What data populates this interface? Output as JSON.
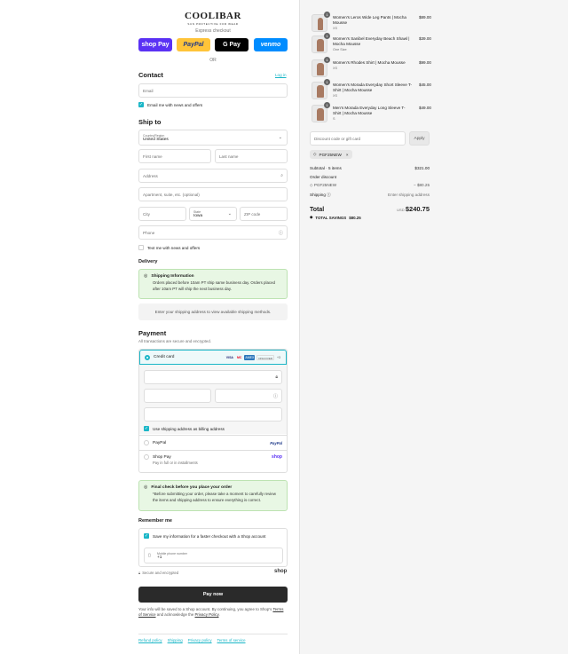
{
  "brand": {
    "name": "COOLIBAR",
    "tagline": "SUN PROTECTIVE FOR WEAR"
  },
  "express": {
    "label": "Express checkout",
    "buttons": [
      "shop Pay",
      "PayPal",
      "G Pay",
      "venmo"
    ],
    "or_label": "OR"
  },
  "contact": {
    "heading": "Contact",
    "login_link": "Log in",
    "email_placeholder": "Email",
    "news_label": "Email me with news and offers"
  },
  "ship": {
    "heading": "Ship to",
    "country_label": "Country/Region",
    "country_value": "United States",
    "first_name_placeholder": "First name",
    "last_name_placeholder": "Last name",
    "address_placeholder": "Address",
    "apt_placeholder": "Apartment, suite, etc. (optional)",
    "city_placeholder": "City",
    "state_label": "State",
    "state_value": "Iowa",
    "zip_placeholder": "ZIP code",
    "phone_placeholder": "Phone",
    "text_label": "Text me with news and offers"
  },
  "delivery": {
    "heading": "Delivery",
    "info_title": "Shipping Information",
    "info_body": "Orders placed before 10am PT ship same business day. Orders placed after 10am PT will ship the next business day.",
    "methods_note": "Enter your shipping address to view available shipping methods."
  },
  "payment": {
    "heading": "Payment",
    "subheading": "All transactions are secure and encrypted.",
    "credit_label": "Credit card",
    "card_brands": [
      "VISA",
      "MC",
      "AMEX",
      "DISCOVER",
      "+3"
    ],
    "billing_label": "Use shipping address as billing address",
    "paypal_label": "PayPal",
    "paypal_logo": "PayPal",
    "shoppay_label": "Shop Pay",
    "shoppay_sub": "Pay in full or in installments",
    "shoppay_logo": "shop"
  },
  "final_check": {
    "title": "Final check before you place your order",
    "body": "*Before submitting your order, please take a moment to carefully review the items and shipping address to ensure everything is correct."
  },
  "remember": {
    "heading": "Remember me",
    "save_label": "Save my information for a faster checkout with a Shop account",
    "mobile_label": "Mobile phone number",
    "mobile_value": "+1",
    "secure_label": "Secure and encrypted",
    "shop_logo": "shop"
  },
  "paynow_label": "Pay now",
  "legal": {
    "text1": "Your info will be saved to a Shop account. By continuing, you agree to Shop's",
    "terms": "Terms of Service",
    "text2": "and acknowledge the",
    "privacy": "Privacy Policy",
    "text3": "."
  },
  "footer": [
    "Refund policy",
    "Shipping",
    "Privacy policy",
    "Terms of service"
  ],
  "cart": {
    "items": [
      {
        "qty": "1",
        "name": "Women's Leros Wide Leg Pants | Mocha Mousse",
        "variant": "XS",
        "price": "$89.00"
      },
      {
        "qty": "1",
        "name": "Women's Sanibel Everyday Beach Shawl | Mocha Mousse",
        "variant": "One Size",
        "price": "$39.00"
      },
      {
        "qty": "1",
        "name": "Women's Rhodes Shirt | Mocha Mousse",
        "variant": "XS",
        "price": "$99.00"
      },
      {
        "qty": "1",
        "name": "Women's Morada Everyday Short Sleeve T-Shirt | Mocha Mousse",
        "variant": "XS",
        "price": "$45.00"
      },
      {
        "qty": "1",
        "name": "Men's Morada Everyday Long Sleeve T-Shirt | Mocha Mousse",
        "variant": "S",
        "price": "$49.00"
      }
    ],
    "discount_placeholder": "Discount code or gift card",
    "apply_label": "Apply",
    "code_tag": "PGF25NEW",
    "subtotal_label": "Subtotal · 5 items",
    "subtotal_value": "$321.00",
    "order_discount_label": "Order discount",
    "discount_code": "PGF25NEW",
    "discount_value": "− $80.25",
    "shipping_label": "Shipping",
    "shipping_value": "Enter shipping address",
    "total_label": "Total",
    "currency": "USD",
    "total_value": "$240.75",
    "savings_label": "TOTAL SAVINGS",
    "savings_value": "$80.25"
  },
  "colors": {
    "accent": "#1ab6c7",
    "shoppay": "#5a31f4",
    "paypal": "#ffc439",
    "venmo": "#008cff",
    "success_bg": "#e8f7e4"
  }
}
